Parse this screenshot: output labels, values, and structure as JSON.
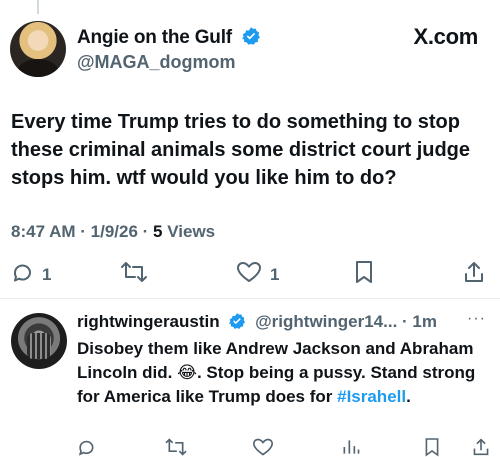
{
  "tweet": {
    "author_name": "Angie on the Gulf",
    "handle": "@MAGA_dogmom",
    "brand": "X.com",
    "text": "Every time Trump tries to do something to stop these criminal animals some district court judge stops him. wtf would you like him to do?",
    "time": "8:47 AM",
    "date": "1/9/26",
    "views_count": "5",
    "views_label": "Views",
    "replies": "1",
    "likes": "1"
  },
  "reply": {
    "author_name": "rightwingeraustin",
    "handle": "@rightwinger14...",
    "time": "1m",
    "more": "···",
    "text_before": "Disobey them like Andrew Jackson and Abraham Lincoln did. 😂.  Stop being a pussy. Stand strong for America like Trump does for ",
    "hashtag": "#Israhell",
    "text_after": "."
  },
  "icons": {
    "verified": "verified-badge-icon",
    "reply": "reply-icon",
    "retweet": "retweet-icon",
    "like": "heart-icon",
    "bookmark": "bookmark-icon",
    "share": "share-icon"
  },
  "colors": {
    "verified": "#1d9bf0",
    "secondary_text": "#536471",
    "hashtag": "#1d9bf0"
  }
}
